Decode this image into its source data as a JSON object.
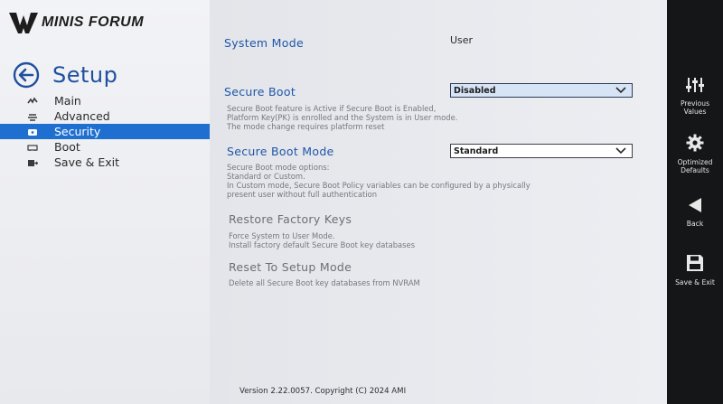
{
  "brand": {
    "logo_text": "MINIS FORUM",
    "accent": "#1e6fd0"
  },
  "sidebar": {
    "title": "Setup",
    "items": [
      {
        "label": "Main",
        "icon": "main-icon",
        "active": false
      },
      {
        "label": "Advanced",
        "icon": "advanced-icon",
        "active": false
      },
      {
        "label": "Security",
        "icon": "security-icon",
        "active": true
      },
      {
        "label": "Boot",
        "icon": "boot-icon",
        "active": false
      },
      {
        "label": "Save & Exit",
        "icon": "save-exit-icon",
        "active": false
      }
    ]
  },
  "main": {
    "system_mode": {
      "label": "System Mode",
      "value": "User"
    },
    "secure_boot": {
      "label": "Secure Boot",
      "value": "Disabled",
      "help": [
        "Secure Boot feature is Active if Secure Boot is Enabled,",
        "Platform Key(PK) is enrolled and the System is in User mode.",
        "The mode change requires platform reset"
      ]
    },
    "secure_boot_mode": {
      "label": "Secure Boot Mode",
      "value": "Standard",
      "help": [
        "Secure Boot mode options:",
        "Standard or Custom.",
        "In Custom mode, Secure Boot Policy variables can be configured by a physically",
        "present user without full authentication"
      ]
    },
    "restore_factory_keys": {
      "label": "Restore Factory Keys",
      "help": [
        "Force System to User Mode.",
        "Install factory default Secure Boot key databases"
      ]
    },
    "reset_to_setup_mode": {
      "label": "Reset To Setup Mode",
      "help": [
        "Delete all Secure Boot key databases from NVRAM"
      ]
    },
    "footer": "Version 2.22.0057. Copyright (C) 2024 AMI"
  },
  "right_panel": {
    "buttons": [
      {
        "label_line1": "Previous",
        "label_line2": "Values",
        "icon": "sliders-icon"
      },
      {
        "label_line1": "Optimized",
        "label_line2": "Defaults",
        "icon": "gear-icon"
      },
      {
        "label_line1": "Back",
        "label_line2": "",
        "icon": "back-triangle-icon"
      },
      {
        "label_line1": "Save & Exit",
        "label_line2": "",
        "icon": "floppy-icon"
      }
    ]
  }
}
